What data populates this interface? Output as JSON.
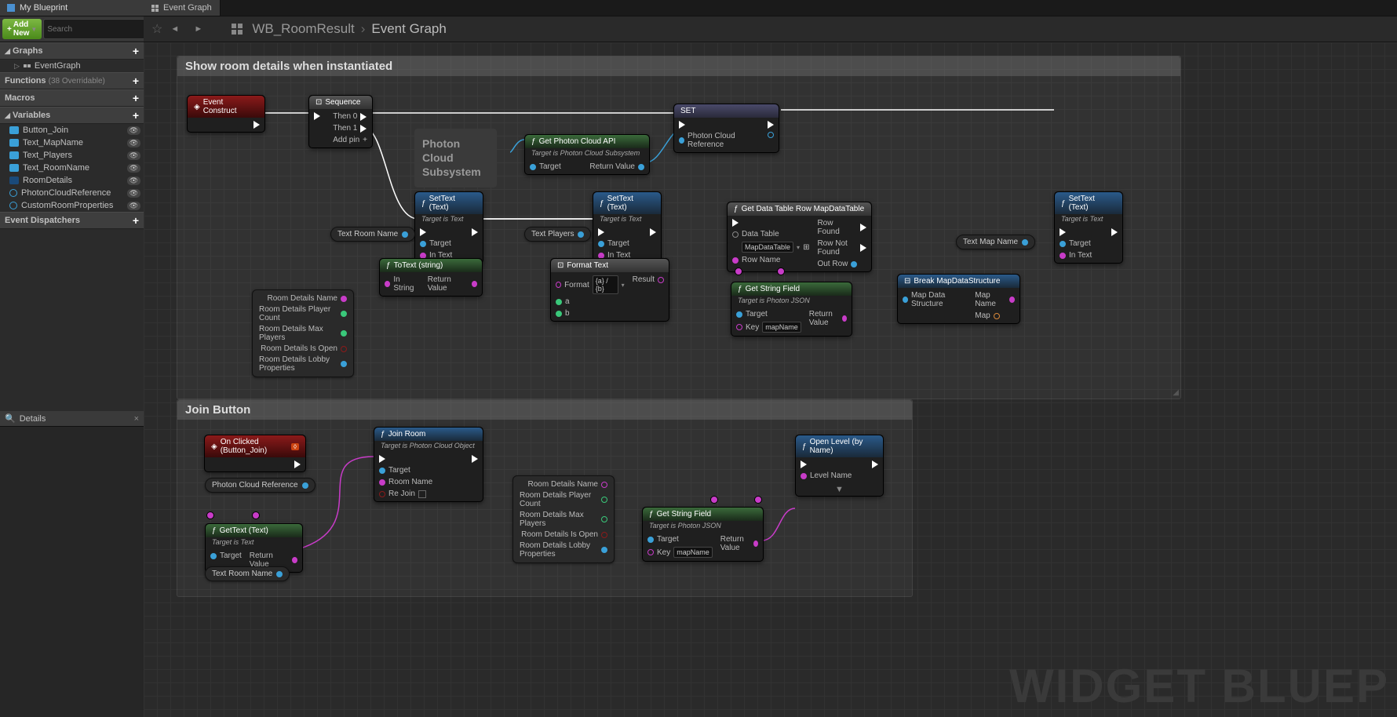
{
  "sidebar": {
    "panelTitle": "My Blueprint",
    "addNew": "Add New",
    "searchPlaceholder": "Search",
    "sections": {
      "graphs": "Graphs",
      "functions": "Functions",
      "functionsSub": "(38 Overridable)",
      "macros": "Macros",
      "variables": "Variables",
      "dispatchers": "Event Dispatchers"
    },
    "graphItems": [
      "EventGraph"
    ],
    "variables": [
      {
        "name": "Button_Join",
        "color": "#3aa0d8",
        "type": "pill"
      },
      {
        "name": "Text_MapName",
        "color": "#3aa0d8",
        "type": "pill"
      },
      {
        "name": "Text_Players",
        "color": "#3aa0d8",
        "type": "pill"
      },
      {
        "name": "Text_RoomName",
        "color": "#3aa0d8",
        "type": "pill"
      },
      {
        "name": "RoomDetails",
        "color": "#1a4a7a",
        "type": "pill"
      },
      {
        "name": "PhotonCloudReference",
        "color": "#3aa0d8",
        "type": "circle"
      },
      {
        "name": "CustomRoomProperties",
        "color": "#3aa0d8",
        "type": "circle"
      }
    ]
  },
  "details": {
    "title": "Details"
  },
  "mainTab": "Event Graph",
  "breadcrumb": {
    "item1": "WB_RoomResult",
    "item2": "Event Graph"
  },
  "watermark": "WIDGET BLUEP",
  "comments": {
    "c1": "Show room details when instantiated",
    "c2": "Join Button"
  },
  "sticky": {
    "photon": "Photon Cloud Subsystem"
  },
  "nodes": {
    "eventConstruct": "Event Construct",
    "sequence": {
      "title": "Sequence",
      "then0": "Then 0",
      "then1": "Then 1",
      "addPin": "Add pin"
    },
    "getPhotonAPI": {
      "title": "Get Photon Cloud API",
      "sub": "Target is Photon Cloud Subsystem",
      "target": "Target",
      "return": "Return Value"
    },
    "set": {
      "title": "SET",
      "ref": "Photon Cloud Reference"
    },
    "setText1": {
      "title": "SetText (Text)",
      "sub": "Target is Text",
      "target": "Target",
      "inText": "In Text"
    },
    "setText2": {
      "title": "SetText (Text)",
      "sub": "Target is Text",
      "target": "Target",
      "inText": "In Text"
    },
    "setText3": {
      "title": "SetText (Text)",
      "sub": "Target is Text",
      "target": "Target",
      "inText": "In Text"
    },
    "toText": {
      "title": "ToText (string)",
      "in": "In String",
      "return": "Return Value"
    },
    "formatText": {
      "title": "Format Text",
      "format": "Format",
      "formatVal": "{a} / {b}",
      "a": "a",
      "b": "b",
      "result": "Result"
    },
    "getDataTable": {
      "title": "Get Data Table Row MapDataTable",
      "dataTable": "Data Table",
      "dtVal": "MapDataTable",
      "rowName": "Row Name",
      "rowFound": "Row Found",
      "rowNotFound": "Row Not Found",
      "outRow": "Out Row"
    },
    "getStringField": {
      "title": "Get String Field",
      "sub": "Target is Photon JSON",
      "target": "Target",
      "key": "Key",
      "keyVal": "mapName",
      "return": "Return Value"
    },
    "getStringField2": {
      "title": "Get String Field",
      "sub": "Target is Photon JSON",
      "target": "Target",
      "key": "Key",
      "keyVal": "mapName",
      "return": "Return Value"
    },
    "breakMapData": {
      "title": "Break MapDataStructure",
      "in": "Map Data Structure",
      "mapName": "Map Name",
      "map": "Map"
    },
    "roomDetails": {
      "name": "Room Details Name",
      "playerCount": "Room Details Player Count",
      "maxPlayers": "Room Details Max Players",
      "isOpen": "Room Details Is Open",
      "lobbyProps": "Room Details Lobby Properties"
    },
    "onClicked": "On Clicked (Button_Join)",
    "joinRoom": {
      "title": "Join Room",
      "sub": "Target is Photon Cloud Object",
      "target": "Target",
      "roomName": "Room Name",
      "reJoin": "Re Join"
    },
    "openLevel": {
      "title": "Open Level (by Name)",
      "levelName": "Level Name"
    },
    "getText": {
      "title": "GetText (Text)",
      "sub": "Target is Text",
      "target": "Target",
      "return": "Return Value"
    },
    "varTextRoomName": "Text Room Name",
    "varTextPlayers": "Text Players",
    "varTextMapName": "Text Map Name",
    "varPhotonCloudRef": "Photon Cloud Reference",
    "varTextRoomName2": "Text Room Name"
  }
}
